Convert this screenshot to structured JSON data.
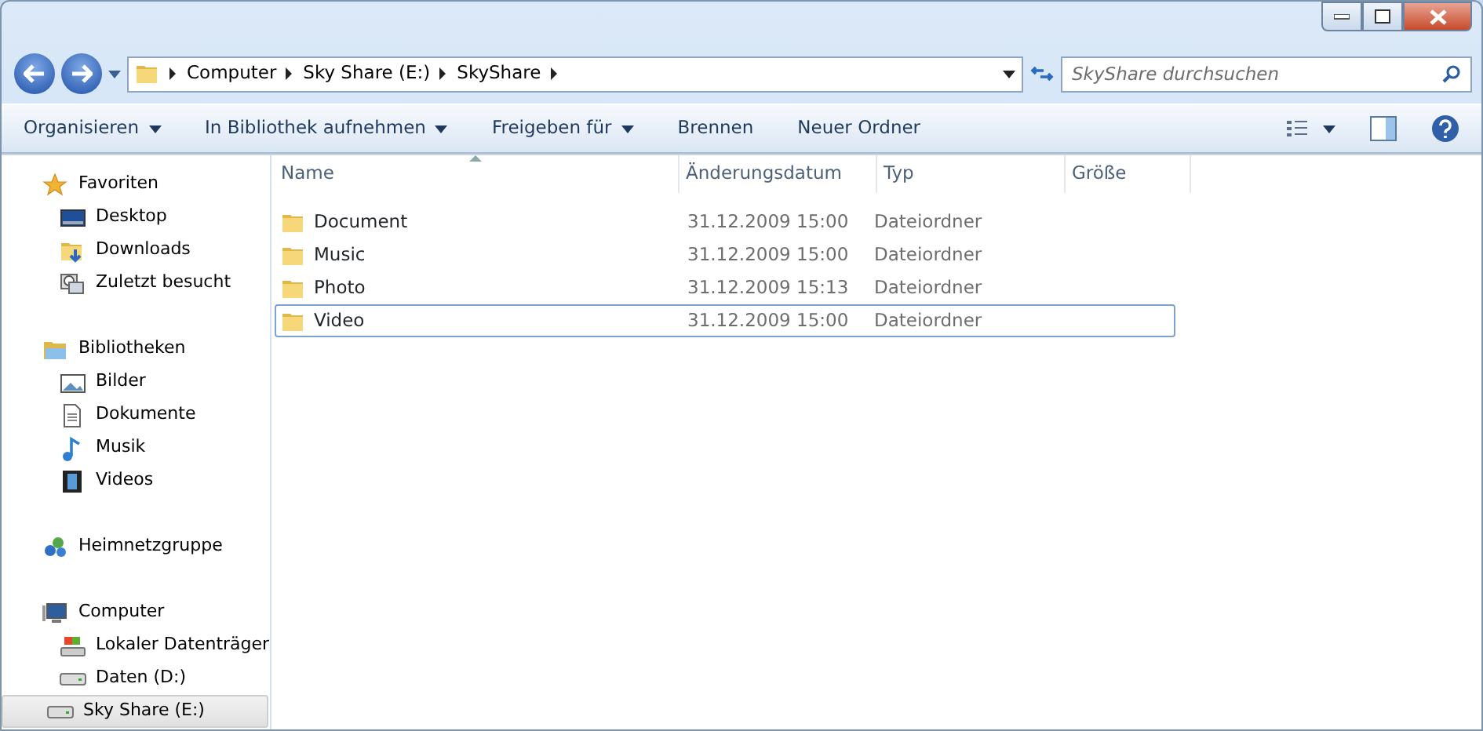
{
  "breadcrumb": [
    "Computer",
    "Sky Share (E:)",
    "SkyShare"
  ],
  "search": {
    "placeholder": "SkyShare durchsuchen"
  },
  "toolbar": [
    {
      "label": "Organisieren",
      "dropdown": true
    },
    {
      "label": "In Bibliothek aufnehmen",
      "dropdown": true
    },
    {
      "label": "Freigeben für",
      "dropdown": true
    },
    {
      "label": "Brennen",
      "dropdown": false
    },
    {
      "label": "Neuer Ordner",
      "dropdown": false
    }
  ],
  "sidebar": [
    {
      "label": "Favoriten",
      "selected": false,
      "children": [
        {
          "label": "Desktop",
          "selected": false
        },
        {
          "label": "Downloads",
          "selected": false
        },
        {
          "label": "Zuletzt besucht",
          "selected": false
        }
      ]
    },
    {
      "label": "Bibliotheken",
      "selected": false,
      "children": [
        {
          "label": "Bilder",
          "selected": false
        },
        {
          "label": "Dokumente",
          "selected": false
        },
        {
          "label": "Musik",
          "selected": false
        },
        {
          "label": "Videos",
          "selected": false
        }
      ]
    },
    {
      "label": "Heimnetzgruppe",
      "selected": false
    },
    {
      "label": "Computer",
      "selected": false,
      "children": [
        {
          "label": "Lokaler Datenträger",
          "selected": false
        },
        {
          "label": "Daten (D:)",
          "selected": false
        },
        {
          "label": "Sky Share (E:)",
          "selected": true
        }
      ]
    }
  ],
  "table": {
    "columns": [
      {
        "label": "Name",
        "sorted": true
      },
      {
        "label": "Änderungsdatum",
        "sorted": false
      },
      {
        "label": "Typ",
        "sorted": false
      },
      {
        "label": "Größe",
        "sorted": false
      }
    ],
    "rows": [
      {
        "name": "Document",
        "date": "31.12.2009 15:00",
        "type": "Dateiordner",
        "selected": false
      },
      {
        "name": "Music",
        "date": "31.12.2009 15:00",
        "type": "Dateiordner",
        "selected": false
      },
      {
        "name": "Photo",
        "date": "31.12.2009 15:13",
        "type": "Dateiordner",
        "selected": false
      },
      {
        "name": "Video",
        "date": "31.12.2009 15:00",
        "type": "Dateiordner",
        "selected": true
      }
    ]
  }
}
